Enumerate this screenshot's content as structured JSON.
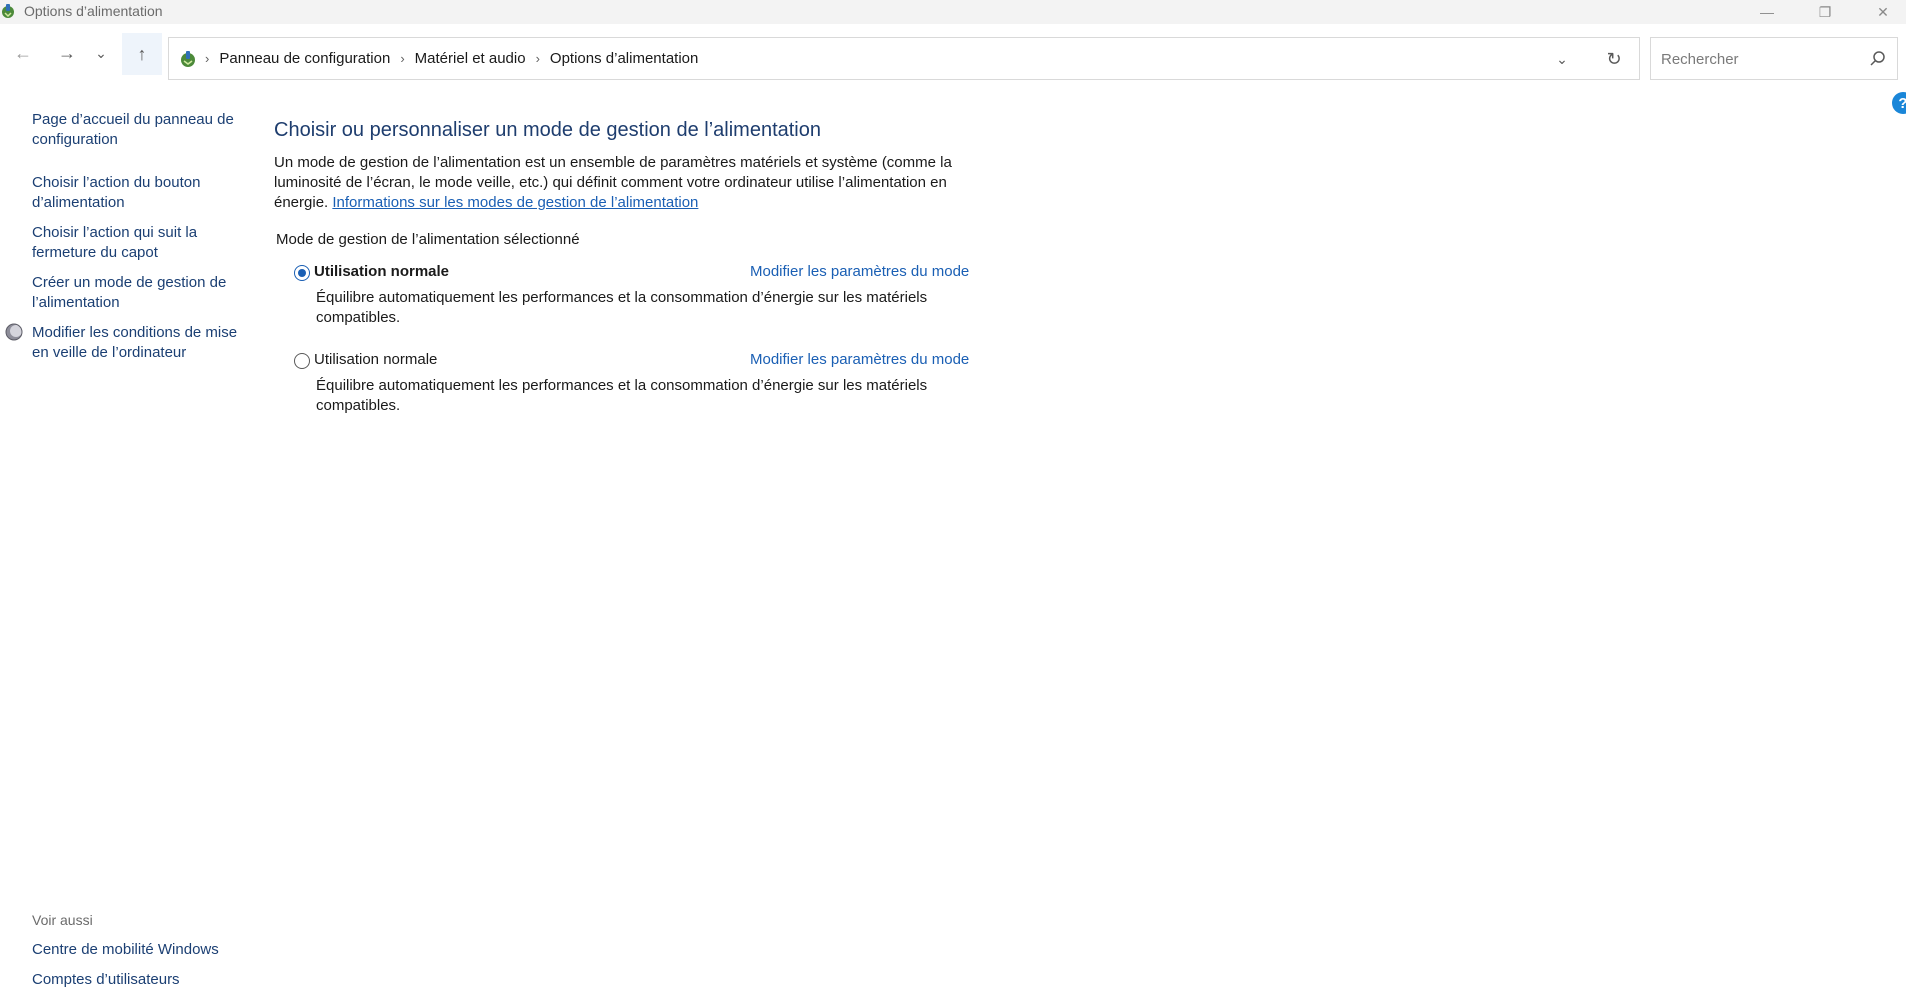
{
  "window": {
    "title": "Options d’alimentation",
    "minimize_glyph": "—",
    "maximize_glyph": "❐",
    "close_glyph": "✕"
  },
  "nav": {
    "back_glyph": "←",
    "forward_glyph": "→",
    "recent_glyph": "⌄",
    "up_glyph": "↑",
    "breadcrumb": [
      "Panneau de configuration",
      "Matériel et audio",
      "Options d’alimentation"
    ],
    "separator": "›",
    "dropdown_glyph": "⌄",
    "refresh_glyph": "↻"
  },
  "search": {
    "placeholder": "Rechercher",
    "value": ""
  },
  "help": {
    "glyph": "?"
  },
  "sidebar": {
    "links": [
      "Page d’accueil du panneau de configuration",
      "Choisir l’action du bouton d’alimentation",
      "Choisir l’action qui suit la fermeture du capot",
      "Créer un mode de gestion de l’alimentation",
      "Modifier les conditions de mise en veille de l’ordinateur"
    ],
    "see_also_label": "Voir aussi",
    "see_also": [
      "Centre de mobilité Windows",
      "Comptes d’utilisateurs"
    ]
  },
  "main": {
    "title": "Choisir ou personnaliser un mode de gestion de l’alimentation",
    "description": "Un mode de gestion de l’alimentation est un ensemble de paramètres matériels et système (comme la luminosité de l’écran, le mode veille, etc.) qui définit comment votre ordinateur utilise l’alimentation en énergie. ",
    "description_link": "Informations sur les modes de gestion de l’alimentation",
    "section_label": "Mode de gestion de l’alimentation sélectionné",
    "plans": [
      {
        "name": "Utilisation normale",
        "selected": true,
        "change_link": "Modifier les paramètres du mode",
        "description": "Équilibre automatiquement les performances et la consommation d’énergie sur les matériels compatibles."
      },
      {
        "name": "Utilisation normale",
        "selected": false,
        "change_link": "Modifier les paramètres du mode",
        "description": "Équilibre automatiquement les performances et la consommation d’énergie sur les matériels compatibles."
      }
    ]
  },
  "colors": {
    "accent": "#1a5fb4",
    "title_blue": "#1e3d6e",
    "nav_link": "#1b3f73",
    "help_blue": "#1a86d8"
  }
}
